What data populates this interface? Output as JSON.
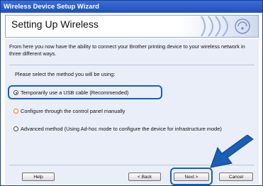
{
  "window": {
    "title": "Wireless Device Setup Wizard"
  },
  "header": {
    "title": "Setting Up Wireless",
    "logo_icon": "wireless-waves-logo-icon"
  },
  "body": {
    "intro": "From here you now have the ability to connect your Brother printing device to your wireless network in three different ways.",
    "prompt": "Please select the method you will be using:",
    "options": [
      {
        "label": "Temporarily use a USB cable (Recommended)",
        "selected": true
      },
      {
        "label": "Configure through the control panel manually",
        "selected": false
      },
      {
        "label": "Advanced method (Using Ad-hoc mode to configure the device for infrastructure mode)",
        "selected": false
      }
    ]
  },
  "buttons": {
    "help": "Help",
    "back": "< Back",
    "next": "Next >",
    "cancel": "Cancel"
  },
  "colors": {
    "title_bar": "#2a5bc6",
    "highlight": "#1a5fb4",
    "body_bg": "#eaeef8"
  }
}
